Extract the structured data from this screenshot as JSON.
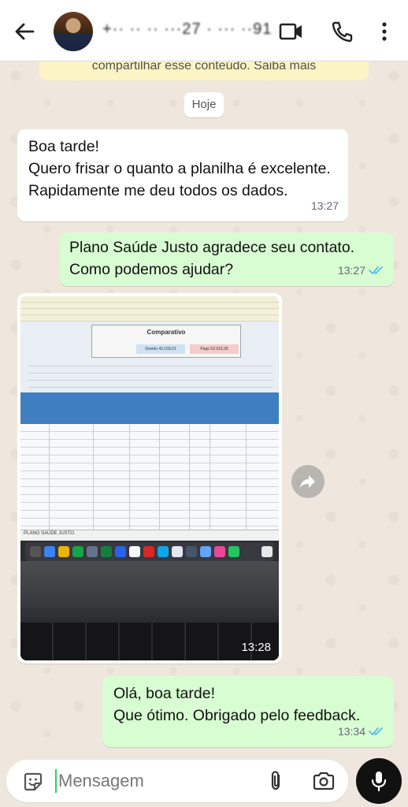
{
  "header": {
    "contact_name": "+·· ·· ·· ···27 · ··· ··91",
    "back_icon": "arrow-left-icon",
    "video_icon": "video-camera-icon",
    "phone_icon": "phone-icon",
    "menu_icon": "more-vertical-icon"
  },
  "banner": {
    "text": "compartilhar esse conteúdo. Saiba mais"
  },
  "date_chip": "Hoje",
  "messages": [
    {
      "direction": "incoming",
      "text": "Boa tarde!\nQuero frisar o quanto a planilha é excelente. Rapidamente me deu todos os dados.",
      "time": "13:27"
    },
    {
      "direction": "outgoing",
      "text": "Plano Saúde Justo agradece seu contato. Como podemos ajudar?",
      "time": "13:27",
      "status": "read"
    },
    {
      "direction": "incoming",
      "type": "image",
      "time": "13:28",
      "image": {
        "sheet_title": "Comparativo",
        "sheet_tab": "PLANO SAÚDE JUSTO",
        "devido": "Devido 43.159,01",
        "pago": "Pago 52.019,35"
      }
    },
    {
      "direction": "outgoing",
      "text": "Olá, boa tarde!\nQue ótimo. Obrigado pelo feedback.",
      "time": "13:34",
      "status": "read"
    }
  ],
  "composer": {
    "placeholder": "Mensagem",
    "value": "",
    "sticker_icon": "sticker-icon",
    "attach_icon": "paperclip-icon",
    "camera_icon": "camera-icon",
    "mic_icon": "microphone-icon"
  },
  "colors": {
    "outgoing_bubble": "#d9fdd3",
    "incoming_bubble": "#ffffff",
    "read_ticks": "#53bdeb",
    "background": "#efe7de",
    "banner": "#fdf4c5"
  }
}
